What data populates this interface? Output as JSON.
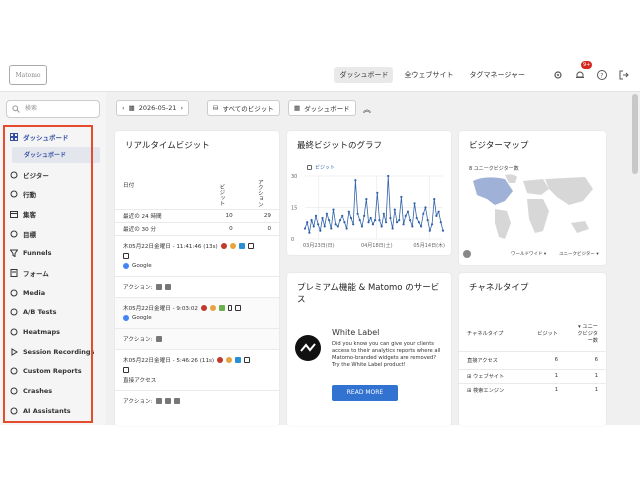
{
  "topbar": {
    "logo_text": "Matomo",
    "nav": [
      "ダッシュボード",
      "全ウェブサイト",
      "タグマネージャー"
    ],
    "notification_count": "9+"
  },
  "sidebar": {
    "search_placeholder": "検索",
    "items": [
      {
        "label": "ダッシュボード",
        "icon": "grid-icon"
      },
      {
        "label": "ビジター",
        "icon": "visitors-icon"
      },
      {
        "label": "行動",
        "icon": "bell-icon"
      },
      {
        "label": "集客",
        "icon": "calendar-icon"
      },
      {
        "label": "目標",
        "icon": "target-icon"
      },
      {
        "label": "Funnels",
        "icon": "funnel-icon"
      },
      {
        "label": "フォーム",
        "icon": "form-icon"
      },
      {
        "label": "Media",
        "icon": "media-icon"
      },
      {
        "label": "A/B Tests",
        "icon": "flask-icon"
      },
      {
        "label": "Heatmaps",
        "icon": "heatmap-icon"
      },
      {
        "label": "Session Recordings",
        "icon": "play-icon"
      },
      {
        "label": "Custom Reports",
        "icon": "report-icon"
      },
      {
        "label": "Crashes",
        "icon": "crash-icon"
      },
      {
        "label": "AI Assistants",
        "icon": "robot-icon"
      }
    ],
    "sub_item": "ダッシュボード"
  },
  "controls": {
    "date": "2026-05-21",
    "segment": "すべてのビジット",
    "dashboard": "ダッシュボード"
  },
  "realtime": {
    "title": "リアルタイムビジット",
    "col_date": "日付",
    "col_visits": "ビジット",
    "col_actions": "アクション",
    "rows": [
      {
        "label": "最近の 24 時間",
        "visits": "10",
        "actions": "29"
      },
      {
        "label": "最近の 30 分",
        "visits": "0",
        "actions": "0"
      }
    ],
    "visits": [
      {
        "time": "木05月22日金曜日 - 11:41:46 (13s)",
        "source": "Google",
        "actions_label": "アクション:"
      },
      {
        "time": "木05月22日金曜日 - 9:03:02",
        "source": "Google",
        "actions_label": "アクション:"
      },
      {
        "time": "木05月22日金曜日 - 5:46:26 (11s)",
        "source": "直接アクセス",
        "actions_label": "アクション:"
      }
    ]
  },
  "graph": {
    "title": "最終ビジットのグラフ",
    "legend": "ビジット",
    "x_labels": [
      "03月23日(日)",
      "04月18日(土)",
      "05月14日(木)"
    ],
    "y_ticks": [
      "30",
      "15",
      "0"
    ]
  },
  "premium": {
    "title": "プレミアム機能 & Matomo のサービス",
    "product": "White Label",
    "text": "Did you know you can give your clients access to their analytics reports where all Matomo-branded widgets are removed? Try the White Label product!",
    "button": "READ MORE"
  },
  "visitor_map": {
    "title": "ビジターマップ",
    "metric": "8 ユニークビジター数",
    "select_region": "ワールドワイド",
    "select_metric": "ユニークビジター"
  },
  "channel": {
    "title": "チャネルタイプ",
    "col_type": "チャネルタイプ",
    "col_visits": "ビジット",
    "col_unique": "ユニークビジター数",
    "rows": [
      {
        "label": "直接アクセス",
        "visits": "6",
        "unique": "6"
      },
      {
        "label": "ウェブサイト",
        "visits": "1",
        "unique": "1"
      },
      {
        "label": "検索エンジン",
        "visits": "1",
        "unique": "1"
      }
    ]
  },
  "colors": {
    "accent": "#3450a3",
    "highlight": "#e44b2f",
    "button": "#3272d1",
    "line": "#3162a8"
  },
  "chart_data": {
    "type": "line",
    "series": [
      {
        "name": "ビジット",
        "values": [
          5,
          8,
          3,
          9,
          6,
          11,
          7,
          4,
          10,
          6,
          12,
          9,
          5,
          14,
          7,
          6,
          9,
          11,
          8,
          5,
          13,
          10,
          7,
          28,
          12,
          9,
          6,
          11,
          19,
          8,
          10,
          7,
          9,
          22,
          9,
          6,
          12,
          8,
          30,
          10,
          5,
          14,
          8,
          9,
          20,
          7,
          11,
          13,
          9,
          6,
          17,
          10,
          8,
          6,
          12,
          15,
          9,
          4,
          7,
          19,
          11,
          13,
          8,
          4
        ]
      }
    ],
    "x_labels": [
      "03月23日(日)",
      "04月18日(土)",
      "05月14日(木)"
    ],
    "ylim": [
      0,
      30
    ]
  }
}
